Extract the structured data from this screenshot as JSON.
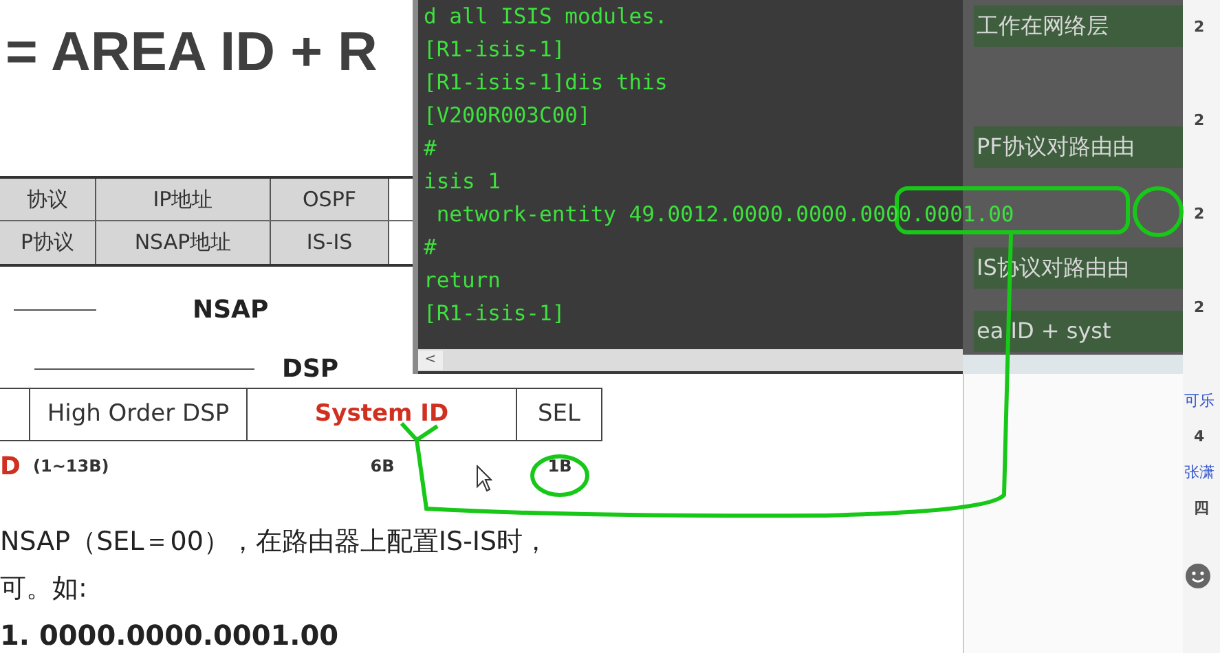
{
  "slide": {
    "title": "= AREA ID + R",
    "compare_table": [
      [
        "协议",
        "IP地址",
        "OSPF"
      ],
      [
        "P协议",
        "NSAP地址",
        "IS-IS"
      ]
    ],
    "nsap_label": "NSAP",
    "dsp_label": "DSP",
    "fields": [
      {
        "label": "High Order DSP",
        "kind": "plain"
      },
      {
        "label": "System ID",
        "kind": "highlight"
      },
      {
        "label": "SEL",
        "kind": "plain"
      }
    ],
    "sizes": [
      {
        "label": "D",
        "kind": "highlight"
      },
      {
        "label": "(1~13B)",
        "kind": "note"
      },
      {
        "label": "6B",
        "kind": "note"
      },
      {
        "label": "1B",
        "kind": "note"
      }
    ],
    "paragraph": [
      "NSAP（SEL＝00），在路由器上配置IS-IS时，",
      "可。如:",
      "1. 0000.0000.0001.00"
    ]
  },
  "terminal": {
    "lines": [
      "d all ISIS modules.",
      "[R1-isis-1]",
      "[R1-isis-1]dis this",
      "[V200R003C00]",
      "#",
      "isis 1",
      " network-entity 49.0012.0000.0000.0000.0001.00",
      "#",
      "return",
      "[R1-isis-1]"
    ],
    "scroll_left": "<"
  },
  "notes": [
    {
      "text": "工作在网络层",
      "highlighted": true
    },
    {
      "text": "PF协议对路由由",
      "highlighted": true
    },
    {
      "text": "IS协议对路由由",
      "highlighted": true
    },
    {
      "text": "ea ID  + syst",
      "highlighted": true
    }
  ],
  "sidebar": [
    {
      "text": "2",
      "kind": "count"
    },
    {
      "text": "2",
      "kind": "count"
    },
    {
      "text": "2",
      "kind": "count"
    },
    {
      "text": "2",
      "kind": "count"
    },
    {
      "text": "可乐",
      "kind": "link"
    },
    {
      "text": "4",
      "kind": "count"
    },
    {
      "text": "张潇",
      "kind": "link"
    },
    {
      "text": "四",
      "kind": "count"
    }
  ]
}
